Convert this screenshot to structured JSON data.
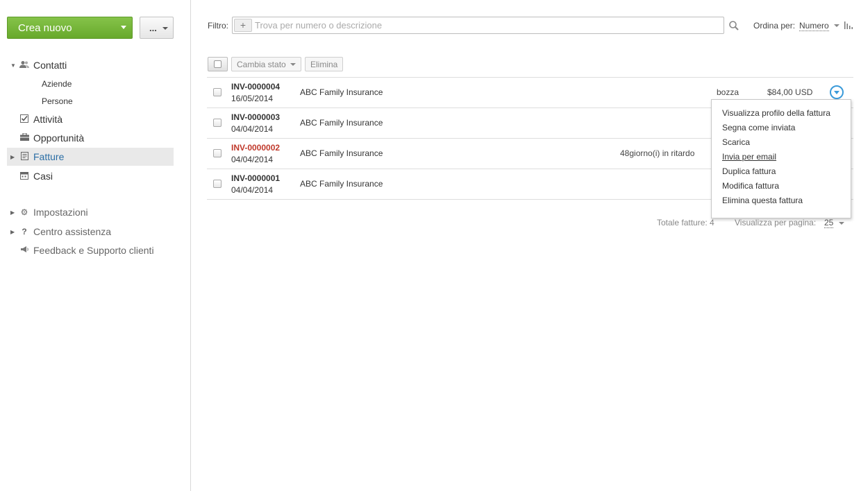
{
  "sidebar": {
    "create_label": "Crea nuovo",
    "more_label": "...",
    "nav": {
      "contacts": "Contatti",
      "companies": "Aziende",
      "people": "Persone",
      "activities": "Attività",
      "opportunities": "Opportunità",
      "invoices": "Fatture",
      "cases": "Casi",
      "settings": "Impostazioni",
      "help": "Centro assistenza",
      "feedback": "Feedback e Supporto clienti"
    },
    "active_item": "Fatture",
    "active_color": "#2b6ea5"
  },
  "filter": {
    "label": "Filtro:",
    "plus": "+",
    "placeholder": "Trova per numero o descrizione",
    "value": ""
  },
  "sort": {
    "label": "Ordina per:",
    "value": "Numero"
  },
  "toolbar": {
    "change_status": "Cambia stato",
    "delete": "Elimina"
  },
  "invoices": [
    {
      "number": "INV-0000004",
      "date": "16/05/2014",
      "client": "ABC Family Insurance",
      "late": "",
      "status": "bozza",
      "amount": "$84,00 USD",
      "overdue": false
    },
    {
      "number": "INV-0000003",
      "date": "04/04/2014",
      "client": "ABC Family Insurance",
      "late": "",
      "status": "",
      "amount": "",
      "overdue": false
    },
    {
      "number": "INV-0000002",
      "date": "04/04/2014",
      "client": "ABC Family Insurance",
      "late": "48giorno(i) in ritardo",
      "status": "",
      "amount": "",
      "overdue": true
    },
    {
      "number": "INV-0000001",
      "date": "04/04/2014",
      "client": "ABC Family Insurance",
      "late": "",
      "status": "",
      "amount": "",
      "overdue": false
    }
  ],
  "footer": {
    "total": "Totale fatture: 4",
    "per_page_label": "Visualizza per pagina:",
    "per_page_value": "25"
  },
  "menu": {
    "items": [
      "Visualizza profilo della fattura",
      "Segna come inviata",
      "Scarica",
      "Invia per email",
      "Duplica fattura",
      "Modifica fattura",
      "Elimina questa fattura"
    ],
    "hovered": "Invia per email"
  },
  "colors": {
    "brand_green": "#6cae30",
    "overdue_red": "#c0392b",
    "action_blue": "#3a9ad9"
  }
}
